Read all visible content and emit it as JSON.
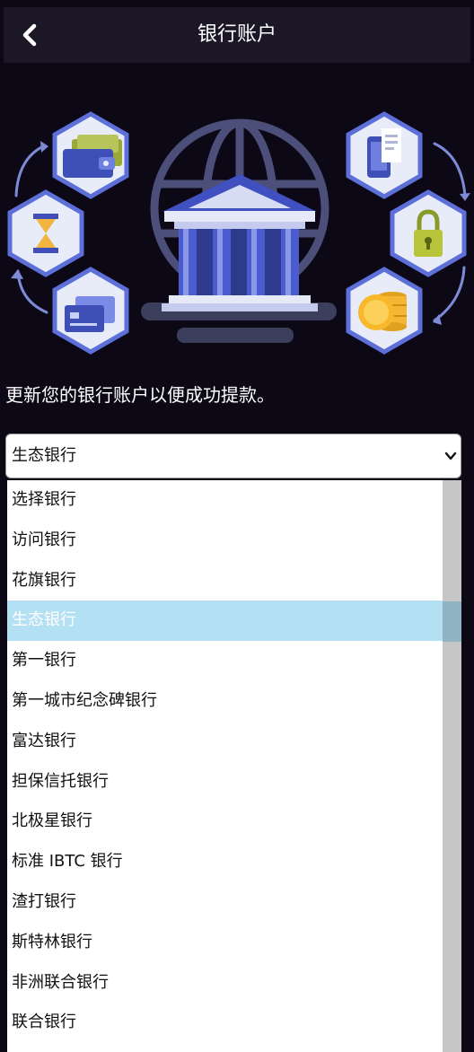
{
  "header": {
    "title": "银行账户"
  },
  "instruction": "更新您的银行账户以便成功提款。",
  "select": {
    "value": "生态银行"
  },
  "options": [
    "选择银行",
    "访问银行",
    "花旗银行",
    "生态银行",
    "第一银行",
    "第一城市纪念碑银行",
    "富达银行",
    "担保信托银行",
    "北极星银行",
    "标准 IBTC 银行",
    "渣打银行",
    "斯特林银行",
    "非洲联合银行",
    "联合银行"
  ],
  "selected_index": 3,
  "colors": {
    "background": "#0c0815",
    "header": "#1c1727",
    "hexagon": "#e8ecf8",
    "hexagon_border": "#5d6fd8",
    "bank_blue": "#4050c0",
    "selected_option": "#b3e0f2"
  },
  "icons": {
    "back": "chevron-left-icon",
    "select_arrow": "chevron-down-icon",
    "illustration_items": [
      "wallet-icon",
      "hourglass-icon",
      "credit-cards-icon",
      "bank-building-icon",
      "globe-icon",
      "phone-receipt-icon",
      "padlock-icon",
      "coins-icon"
    ]
  }
}
